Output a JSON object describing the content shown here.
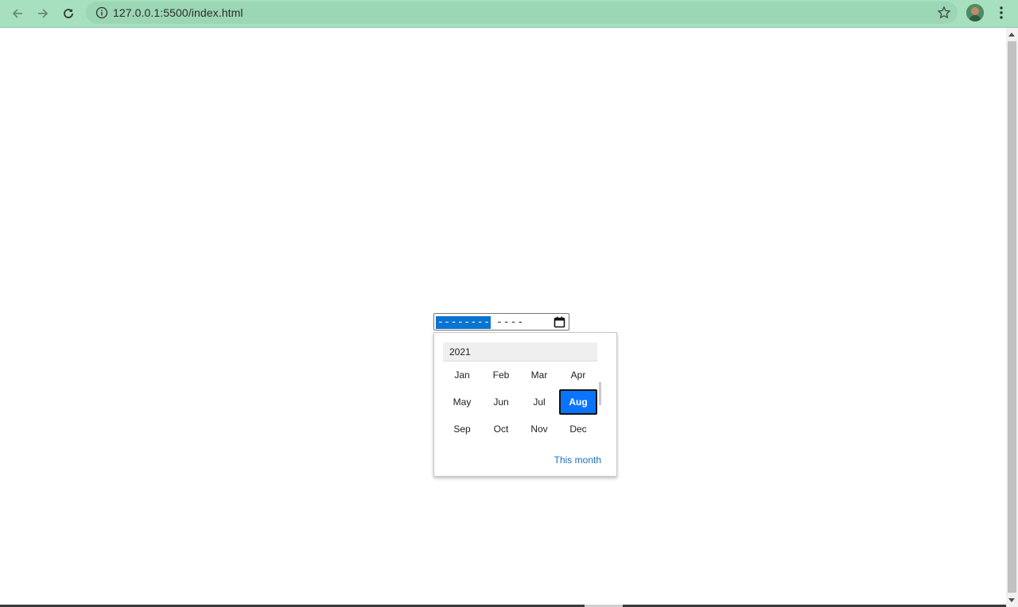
{
  "browser": {
    "url": "127.0.0.1:5500/index.html",
    "back_icon": "arrow-left-icon",
    "forward_icon": "arrow-right-icon",
    "reload_icon": "reload-icon",
    "info_icon": "info-icon",
    "bookmark_icon": "star-icon",
    "menu_icon": "kebab-menu-icon",
    "toolbar_color": "#a6e0bf"
  },
  "date_input": {
    "month_placeholder": "---------",
    "year_placeholder": "----",
    "icon": "calendar-icon"
  },
  "picker": {
    "year": "2021",
    "months": [
      "Jan",
      "Feb",
      "Mar",
      "Apr",
      "May",
      "Jun",
      "Jul",
      "Aug",
      "Sep",
      "Oct",
      "Nov",
      "Dec"
    ],
    "selected_month": "Aug",
    "this_month_label": "This month",
    "accent_color": "#0a74ff"
  }
}
